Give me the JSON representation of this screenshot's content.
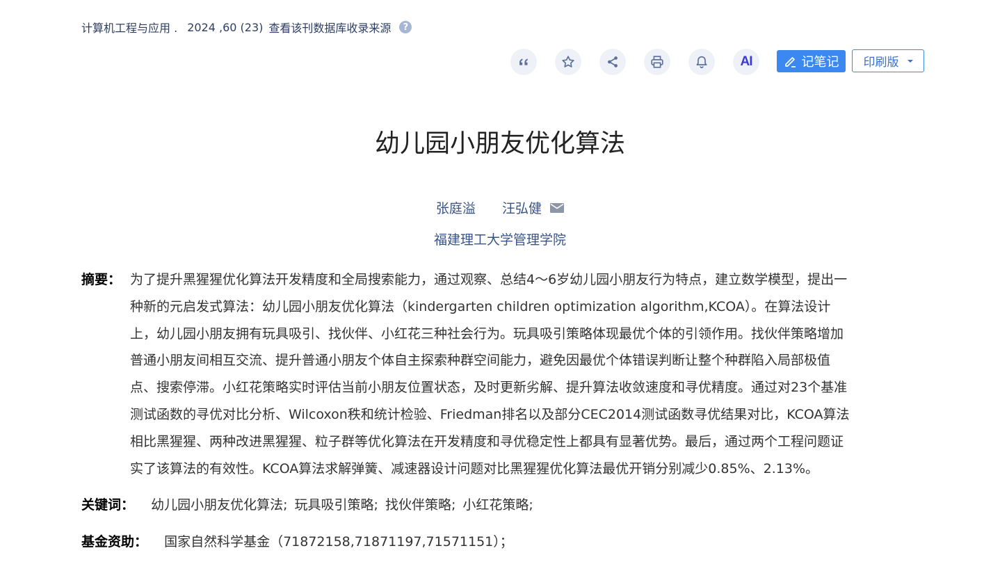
{
  "source": {
    "journal": "计算机工程与应用 .",
    "issue": "2024 ,60 (23)",
    "db_link": "查看该刊数据库收录来源",
    "help_glyph": "?"
  },
  "toolbar": {
    "tools": [
      "quote-icon",
      "star-icon",
      "share-icon",
      "print-icon",
      "bell-icon",
      "ai-icon"
    ],
    "ai_label": "AI",
    "note_label": "记笔记",
    "print_label": "印刷版"
  },
  "article": {
    "title": "幼儿园小朋友优化算法",
    "authors": [
      "张庭溢",
      "汪弘健"
    ],
    "affiliation": "福建理工大学管理学院",
    "abstract_label": "摘要：",
    "abstract_lines": [
      "为了提升黑猩猩优化算法开发精度和全局搜索能力，通过观察、总结4～6岁幼儿园小朋友行为特点，建立数学模型，提出一",
      "种新的元启发式算法：幼儿园小朋友优化算法（kindergarten children optimization algorithm,KCOA）。在算法设计",
      "上，幼儿园小朋友拥有玩具吸引、找伙伴、小红花三种社会行为。玩具吸引策略体现最优个体的引领作用。找伙伴策略增加",
      "普通小朋友间相互交流、提升普通小朋友个体自主探索种群空间能力，避免因最优个体错误判断让整个种群陷入局部极值",
      "点、搜索停滞。小红花策略实时评估当前小朋友位置状态，及时更新劣解、提升算法收敛速度和寻优精度。通过对23个基准",
      "测试函数的寻优对比分析、Wilcoxon秩和统计检验、Friedman排名以及部分CEC2014测试函数寻优结果对比，KCOA算法",
      "相比黑猩猩、两种改进黑猩猩、粒子群等优化算法在开发精度和寻优稳定性上都具有显著优势。最后，通过两个工程问题证",
      "实了该算法的有效性。KCOA算法求解弹簧、减速器设计问题对比黑猩猩优化算法最优开销分别减少0.85%、2.13%。"
    ],
    "keywords_label": "关键词：",
    "keywords": [
      "幼儿园小朋友优化算法;",
      "玩具吸引策略;",
      "找伙伴策略;",
      "小红花策略;"
    ],
    "funding_label": "基金资助：",
    "funding": "国家自然科学基金（71872158,71871197,71571151）；"
  }
}
